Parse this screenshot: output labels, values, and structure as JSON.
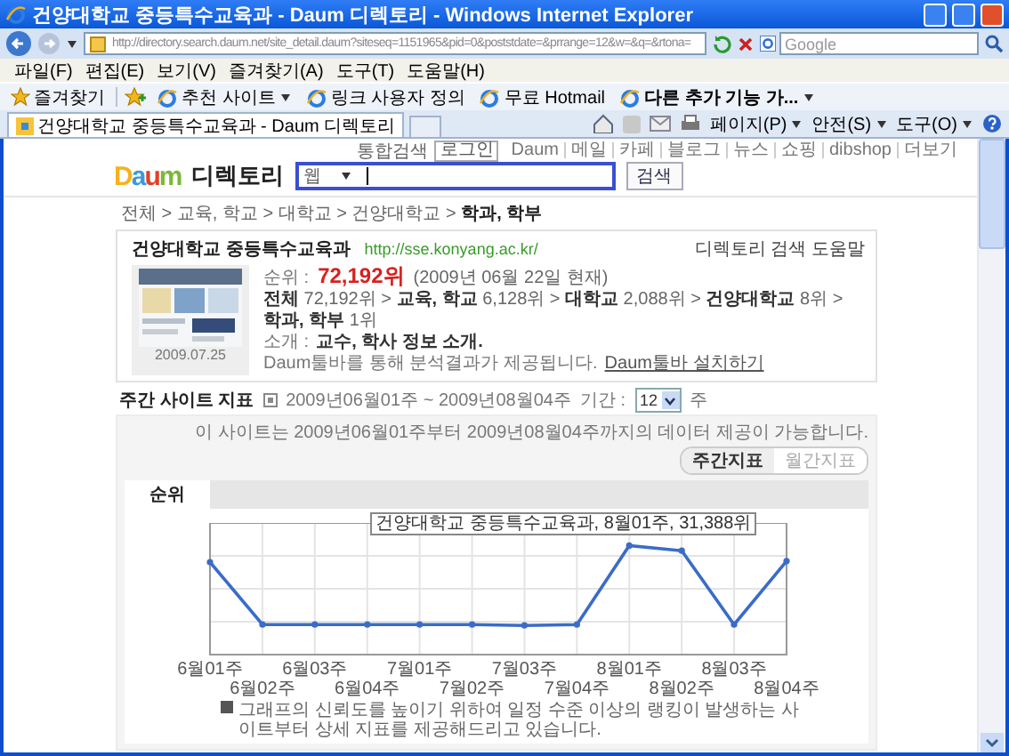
{
  "window": {
    "title": "건양대학교 중등특수교육과 - Daum 디렉토리 - Windows Internet Explorer"
  },
  "address_bar": {
    "url": "http://directory.search.daum.net/site_detail.daum?siteseq=1151965&pid=0&poststdate=&prrange=12&w=&q=&rtona=",
    "search_placeholder": "Google"
  },
  "menu_bar": [
    "파일(F)",
    "편집(E)",
    "보기(V)",
    "즐겨찾기(A)",
    "도구(T)",
    "도움말(H)"
  ],
  "favorites_bar": {
    "favorites_button": "즐겨찾기",
    "links": [
      {
        "label": "추천 사이트",
        "has_menu": true
      },
      {
        "label": "링크 사용자 정의",
        "has_menu": false
      },
      {
        "label": "무료 Hotmail",
        "has_menu": false
      },
      {
        "label": "다른 추가 기능 가...",
        "has_menu": true
      }
    ]
  },
  "tabs": [
    {
      "label": "건양대학교 중등특수교육과 - Daum 디렉토리",
      "selected": true
    }
  ],
  "command_bar": [
    "페이지(P)",
    "안전(S)",
    "도구(O)"
  ],
  "page": {
    "top_links": {
      "search_link": "통합검색",
      "login": "로그인",
      "services": [
        "Daum",
        "메일",
        "카페",
        "블로그",
        "뉴스",
        "쇼핑",
        "dibshop",
        "더보기"
      ]
    },
    "logo": {
      "brand": "Daum",
      "section": "디렉토리"
    },
    "search": {
      "scope": "웹",
      "button": "검색"
    },
    "breadcrumb": "전체 > 교육, 학교 > 대학교 > 건양대학교 > **학과, 학부**",
    "site": {
      "name": "건양대학교 중등특수교육과",
      "url": "http://sse.konyang.ac.kr/",
      "help_link": "디렉토리 검색 도움말",
      "rank_label": "순위 :",
      "rank": "72,192위",
      "rank_date": "(2009년 06월 22일 현재)",
      "path": "**전체** 72,192위 > **교육, 학교** 6,128위 > **대학교** 2,088위 > **건양대학교** 8위 > **학과, 학부** 1위",
      "intro_label": "소개 :",
      "intro": "교수, 학사 정보 소개.",
      "toolbar_note": "Daum툴바를 통해 분석결과가 제공됩니다.",
      "toolbar_link": "Daum툴바 설치하기",
      "thumbnail_date": "2009.07.25"
    },
    "weekly": {
      "title": "주간 사이트 지표",
      "range": "2009년06월01주 ~ 2009년08월04주",
      "period_label": "기간 :",
      "period": "12",
      "period_unit": "주",
      "availability": "이 사이트는 2009년06월01주부터 2009년08월04주까지의 데이터 제공이 가능합니다.",
      "views": [
        {
          "label": "주간지표",
          "selected": true
        },
        {
          "label": "월간지표",
          "selected": false
        }
      ],
      "chart_tabs": [
        {
          "label": "순위",
          "selected": true
        }
      ],
      "chart": {
        "tooltip": "건양대학교 중등특수교육과, 8월01주, 31,388위",
        "x_labels": [
          "6월01주",
          "6월02주",
          "6월03주",
          "6월04주",
          "7월01주",
          "7월02주",
          "7월03주",
          "7월04주",
          "8월01주",
          "8월02주",
          "8월03주",
          "8월04주"
        ]
      },
      "note": "그래프의 신뢰도를 높이기 위하여 일정 수준 이상의 랭킹이 발생하는 사이트부터 상세 지표를 제공해드리고 있습니다."
    }
  }
}
